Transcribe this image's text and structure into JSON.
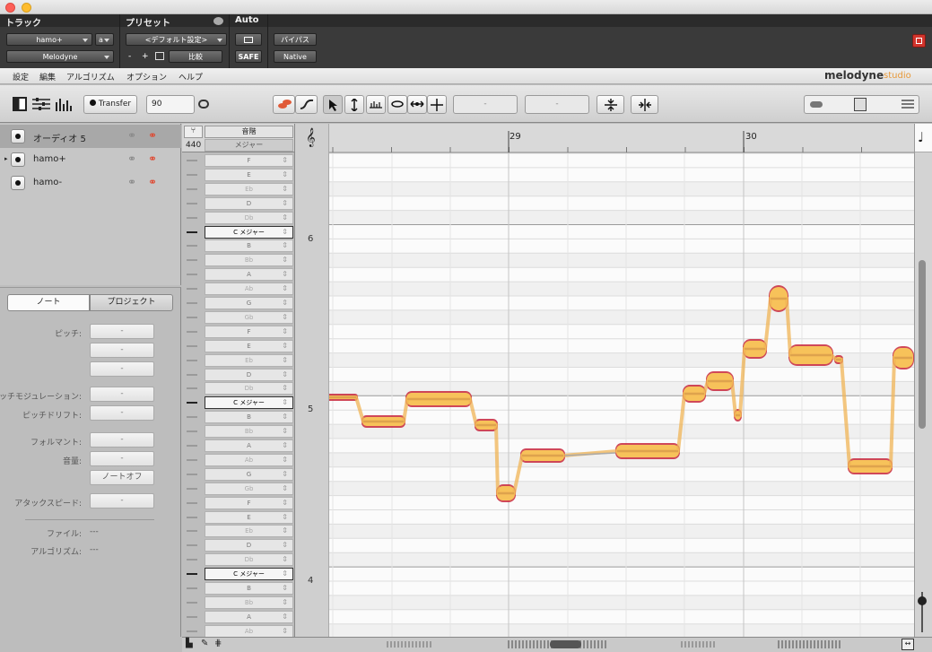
{
  "host": {
    "track_header": "トラック",
    "preset_header": "プリセット",
    "auto_header": "Auto",
    "track_name": "hamo+",
    "track_letter": "a",
    "plugin": "Melodyne",
    "preset": "<デフォルト設定>",
    "minus": "-",
    "plus": "+",
    "compare": "比較",
    "safe": "SAFE",
    "bypass": "バイパス",
    "native": "Native"
  },
  "menu": [
    "設定",
    "編集",
    "アルゴリズム",
    "オプション",
    "ヘルプ"
  ],
  "logo": {
    "main": "melodyne",
    "sub": "studio"
  },
  "toolbar": {
    "transfer": "Transfer",
    "tempo": "90",
    "field1": "-",
    "field2": "-"
  },
  "tracks": [
    {
      "name": "オーディオ 5",
      "selected": true
    },
    {
      "name": "hamo+",
      "selected": false
    },
    {
      "name": "hamo-",
      "selected": false
    }
  ],
  "inspector": {
    "tab_note": "ノート",
    "tab_project": "プロジェクト",
    "pitch": "ピッチ:",
    "pitch_mod": "ピッチモジュレーション:",
    "pitch_drift": "ピッチドリフト:",
    "formant": "フォルマント:",
    "volume": "音量:",
    "note_off": "ノートオフ",
    "attack": "アタックスピード:",
    "dash": "-",
    "file_label": "ファイル:",
    "file_value": "---",
    "algo_label": "アルゴリズム:",
    "algo_value": "---"
  },
  "keys": {
    "scale_header": "音階",
    "scale_mode": "メジャー",
    "tuning": "440",
    "notes": [
      "F",
      "E",
      "Eb",
      "D",
      "Db",
      "C メジャー",
      "B",
      "Bb",
      "A",
      "Ab",
      "G",
      "Gb",
      "F",
      "E",
      "Eb",
      "D",
      "Db",
      "C メジャー",
      "B",
      "Bb",
      "A",
      "Ab",
      "G",
      "Gb",
      "F",
      "E",
      "Eb",
      "D",
      "Db",
      "C メジャー",
      "B",
      "Bb",
      "A",
      "Ab"
    ],
    "octaves": [
      "6",
      "5",
      "4"
    ]
  },
  "ruler": {
    "bars": [
      "29",
      "30"
    ]
  },
  "colors": {
    "blob_core": "#f7c25a",
    "blob_edge": "#c8283c",
    "accent": "#e0442c",
    "pitch_line": "#f0b456"
  }
}
